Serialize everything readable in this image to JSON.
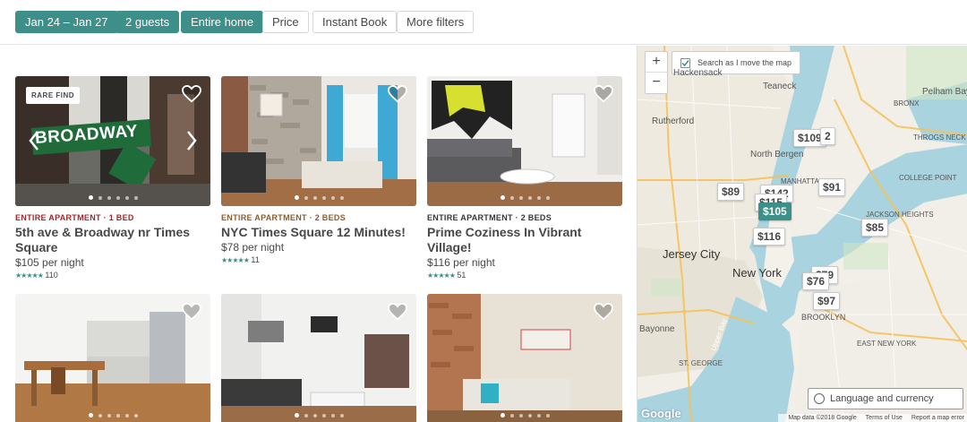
{
  "filters": [
    {
      "label": "Jan 24 – Jan 27",
      "active": true
    },
    {
      "label": "2 guests",
      "active": true
    },
    {
      "label": "Entire home",
      "active": true
    },
    {
      "label": "Price",
      "active": false
    },
    {
      "label": "Instant Book",
      "active": false
    },
    {
      "label": "More filters",
      "active": false
    }
  ],
  "listings": [
    {
      "badge": "RARE FIND",
      "kind": "ENTIRE APARTMENT · 1 BED",
      "title": "5th ave & Broadway nr Times Square",
      "price": "$105 per night",
      "stars": "★★★★★",
      "reviews": "110",
      "photo_text": "BROADWAY",
      "photo_progress": "1 of 6",
      "kind_color": "#a1282b"
    },
    {
      "badge": "",
      "kind": "ENTIRE APARTMENT · 2 BEDS",
      "title": "NYC Times Square 12 Minutes!",
      "price": "$78 per night",
      "stars": "★★★★★",
      "reviews": "11",
      "photo_progress": "1 of 6",
      "kind_color": "#8a5d2f"
    },
    {
      "badge": "",
      "kind": "ENTIRE APARTMENT · 2 BEDS",
      "title": "Prime Coziness In Vibrant Village!",
      "price": "$116 per night",
      "stars": "★★★★★",
      "reviews": "51",
      "photo_progress": "1 of 6",
      "kind_color": "#383838"
    },
    {
      "photo_progress": "1 of 6"
    },
    {
      "photo_progress": "1 of 6"
    },
    {
      "photo_progress": "1 of 6"
    }
  ],
  "map": {
    "zoom_in": "+",
    "zoom_out": "−",
    "search_toggle": "Search as I move the map",
    "pins": [
      {
        "label": "$109"
      },
      {
        "label": "2"
      },
      {
        "label": "$89"
      },
      {
        "label": "$142"
      },
      {
        "label": "$91"
      },
      {
        "label": "$115"
      },
      {
        "label": "$105",
        "selected": true
      },
      {
        "label": "$85"
      },
      {
        "label": "$116"
      },
      {
        "label": "$79"
      },
      {
        "label": "$76"
      },
      {
        "label": "$97"
      }
    ],
    "places": [
      "Hackensack",
      "Teaneck",
      "Rutherford",
      "North Bergen",
      "Pelham Bay Park",
      "BRONX",
      "THROGS NECK",
      "COLLEGE POINT",
      "MANHATTAN",
      "JACKSON HEIGHTS",
      "Jersey City",
      "New York",
      "BROOKLYN",
      "Bayonne",
      "EAST NEW YORK",
      "ST. GEORGE",
      "Upper Bay"
    ],
    "currency_button": "Language and currency",
    "google": "Google",
    "attribution": [
      "Map data ©2018 Google",
      "Terms of Use",
      "Report a map error"
    ]
  },
  "colors": {
    "accent": "#3d8f8a",
    "water": "#a9d3df",
    "land": "#f2efe9"
  }
}
